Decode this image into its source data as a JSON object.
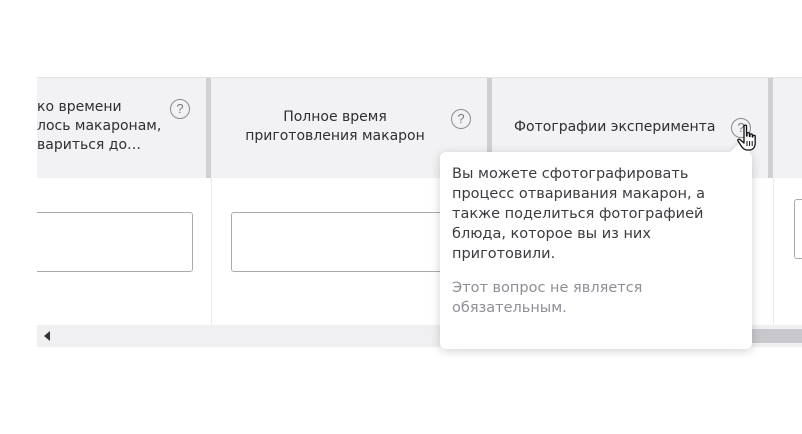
{
  "table": {
    "columns": [
      {
        "header": "ко времени\nлось макаронам,\nвариться до…",
        "help": "?"
      },
      {
        "header": "Полное время\nприготовления макарон",
        "help": "?"
      },
      {
        "header": "Фотографии эксперимента",
        "help": "?"
      }
    ]
  },
  "tooltip": {
    "text": "Вы можете сфотографировать\nпроцесс отваривания макарон, а\nтакже поделиться фотографией\nблюда, которое вы из них\nприготовили.",
    "note": "Этот вопрос не является\nобязательным."
  },
  "icons": {
    "help": "question-circle-icon",
    "cursor": "hand-pointer-icon",
    "scroll_left": "arrow-left-icon"
  }
}
